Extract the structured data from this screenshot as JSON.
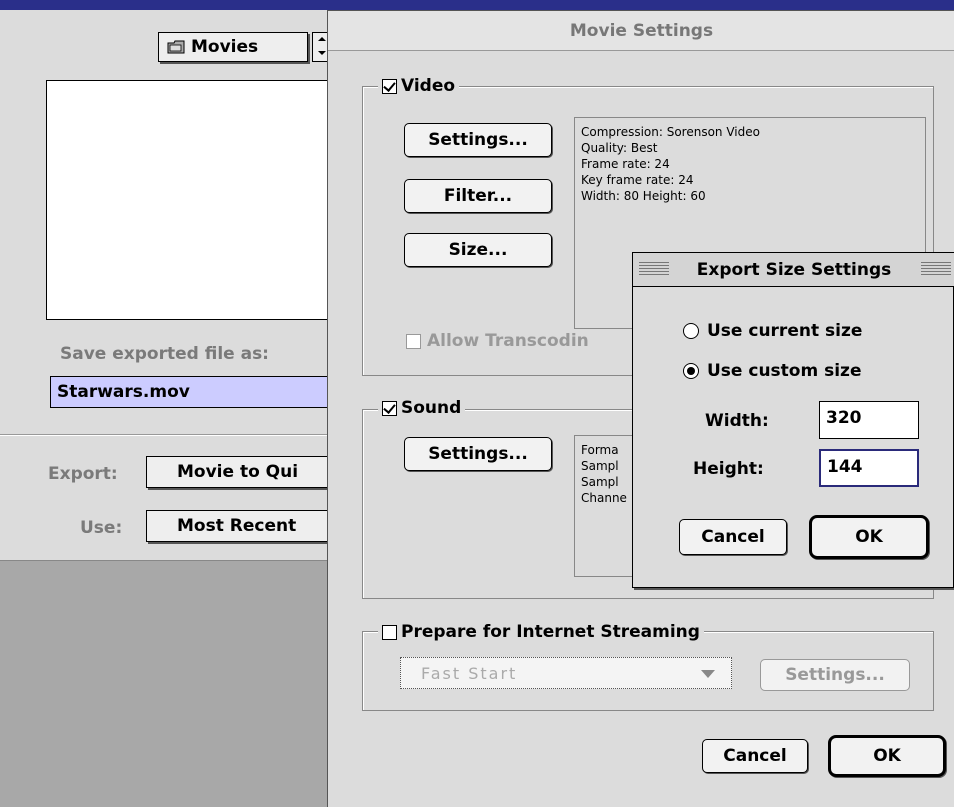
{
  "export_dialog": {
    "folder_popup": "Movies",
    "save_label": "Save exported file as:",
    "filename": "Starwars.mov",
    "export_label": "Export:",
    "export_value": "Movie to Qui",
    "use_label": "Use:",
    "use_value": "Most Recent"
  },
  "movie_settings": {
    "title": "Movie Settings",
    "video": {
      "label": "Video",
      "checked": true,
      "settings_button": "Settings...",
      "filter_button": "Filter...",
      "size_button": "Size...",
      "info": [
        "Compression: Sorenson Video",
        "Quality: Best",
        "Frame rate: 24",
        "Key frame rate: 24",
        "Width: 80 Height: 60"
      ],
      "allow_transcoding": "Allow Transcodin"
    },
    "sound": {
      "label": "Sound",
      "checked": true,
      "settings_button": "Settings...",
      "info": [
        "Forma",
        "Sampl",
        "Sampl",
        "Channe"
      ]
    },
    "streaming": {
      "label": "Prepare for Internet Streaming",
      "checked": false,
      "popup_value": "Fast Start",
      "settings_button": "Settings..."
    },
    "cancel_button": "Cancel",
    "ok_button": "OK"
  },
  "export_size": {
    "title": "Export Size Settings",
    "option_current": "Use current size",
    "option_custom": "Use custom size",
    "selected": "custom",
    "width_label": "Width:",
    "width_value": "320",
    "height_label": "Height:",
    "height_value": "144",
    "cancel_button": "Cancel",
    "ok_button": "OK"
  },
  "colors": {
    "desktop": "#1c1f7a",
    "dialog_bg": "#dcdcdc",
    "filename_highlight": "#ccccff"
  }
}
